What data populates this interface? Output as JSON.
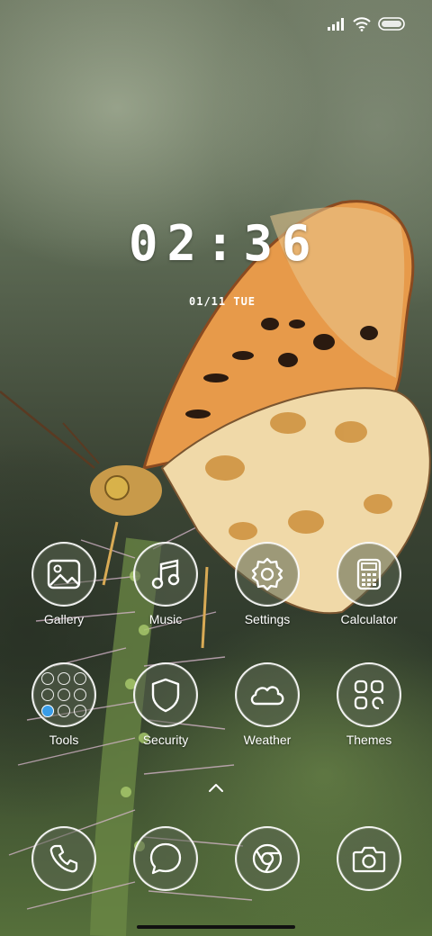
{
  "status_bar": {
    "icons": [
      "signal-icon",
      "wifi-icon",
      "battery-icon"
    ]
  },
  "clock": {
    "time": "02:36",
    "date": "01/11 TUE"
  },
  "apps": [
    {
      "name": "Gallery",
      "icon": "gallery-icon"
    },
    {
      "name": "Music",
      "icon": "music-icon"
    },
    {
      "name": "Settings",
      "icon": "settings-icon"
    },
    {
      "name": "Calculator",
      "icon": "calculator-icon"
    },
    {
      "name": "Tools",
      "icon": "tools-folder-icon"
    },
    {
      "name": "Security",
      "icon": "shield-icon"
    },
    {
      "name": "Weather",
      "icon": "cloud-icon"
    },
    {
      "name": "Themes",
      "icon": "themes-icon"
    }
  ],
  "dock": [
    {
      "icon": "phone-icon"
    },
    {
      "icon": "messages-icon"
    },
    {
      "icon": "chrome-icon"
    },
    {
      "icon": "camera-icon"
    }
  ]
}
